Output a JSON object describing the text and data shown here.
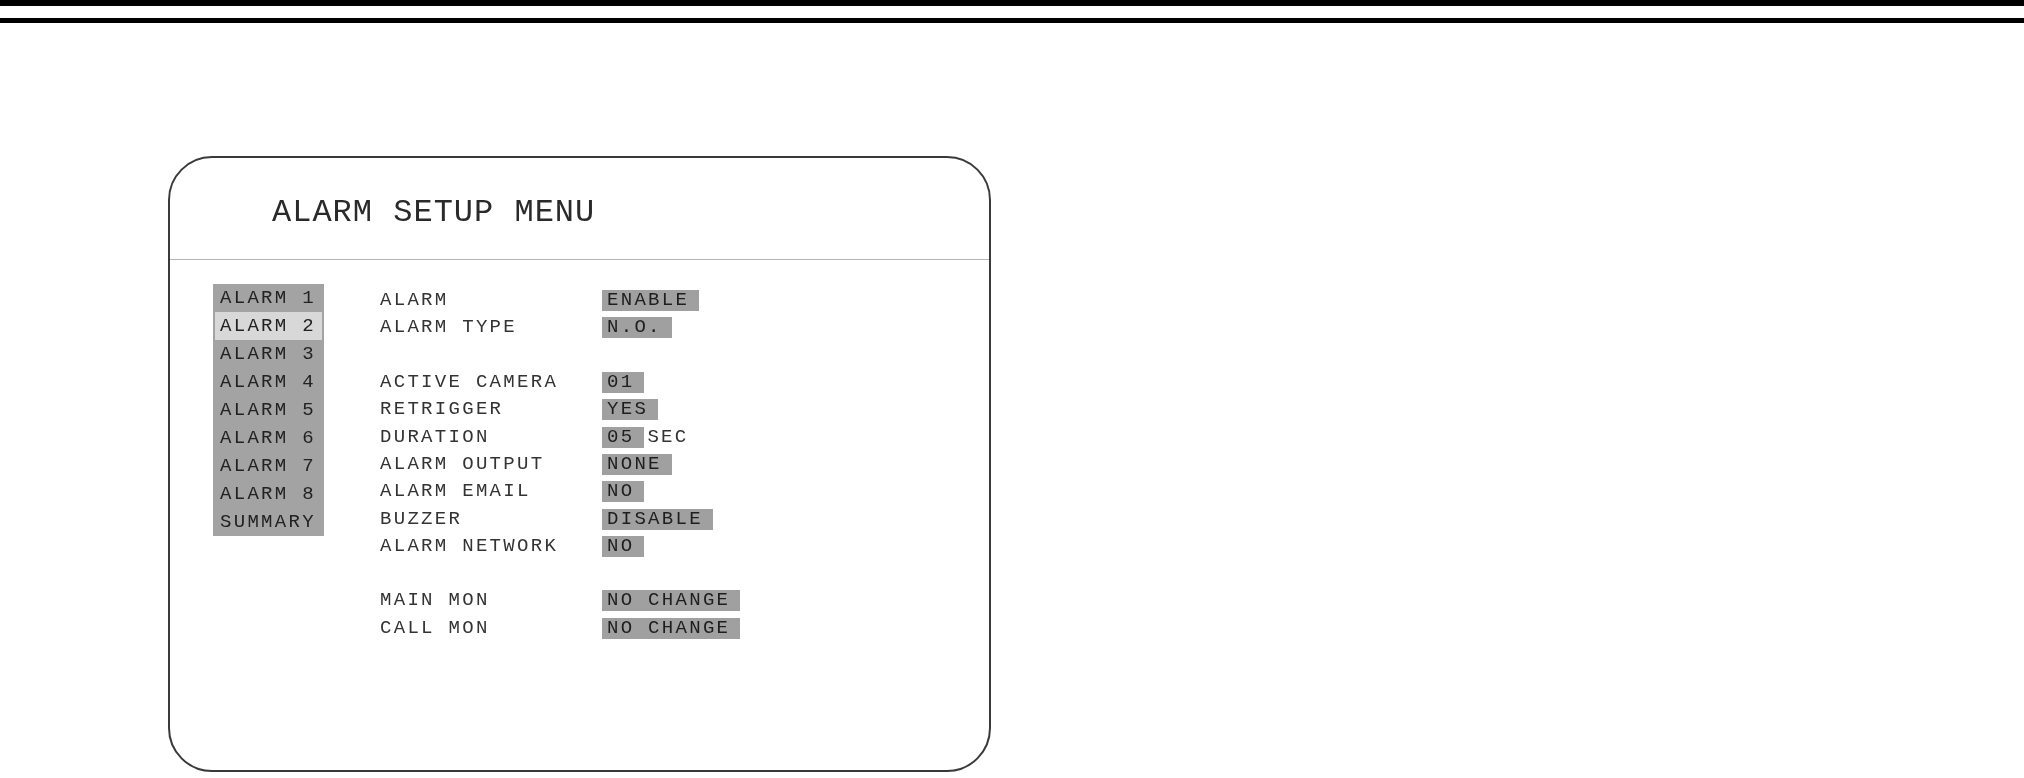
{
  "menu": {
    "title": "ALARM SETUP MENU",
    "alarm_list": [
      {
        "label": "ALARM 1",
        "selected": false
      },
      {
        "label": "ALARM 2",
        "selected": true
      },
      {
        "label": "ALARM 3",
        "selected": false
      },
      {
        "label": "ALARM 4",
        "selected": false
      },
      {
        "label": "ALARM 5",
        "selected": false
      },
      {
        "label": "ALARM 6",
        "selected": false
      },
      {
        "label": "ALARM 7",
        "selected": false
      },
      {
        "label": "ALARM 8",
        "selected": false
      },
      {
        "label": "SUMMARY",
        "selected": false
      }
    ],
    "setting_groups": [
      {
        "rows": [
          {
            "label": "ALARM",
            "value": "ENABLE"
          },
          {
            "label": "ALARM TYPE",
            "value": "N.O."
          }
        ]
      },
      {
        "rows": [
          {
            "label": "ACTIVE CAMERA",
            "value": "01"
          },
          {
            "label": "RETRIGGER",
            "value": "YES"
          },
          {
            "label": "DURATION",
            "value": "05",
            "unit": "SEC"
          },
          {
            "label": "ALARM OUTPUT",
            "value": "NONE"
          },
          {
            "label": "ALARM EMAIL",
            "value": "NO"
          },
          {
            "label": "BUZZER",
            "value": "DISABLE"
          },
          {
            "label": "ALARM NETWORK",
            "value": "NO"
          }
        ]
      },
      {
        "rows": [
          {
            "label": "MAIN MON",
            "value": "NO CHANGE"
          },
          {
            "label": "CALL MON",
            "value": "NO CHANGE"
          }
        ]
      }
    ]
  }
}
